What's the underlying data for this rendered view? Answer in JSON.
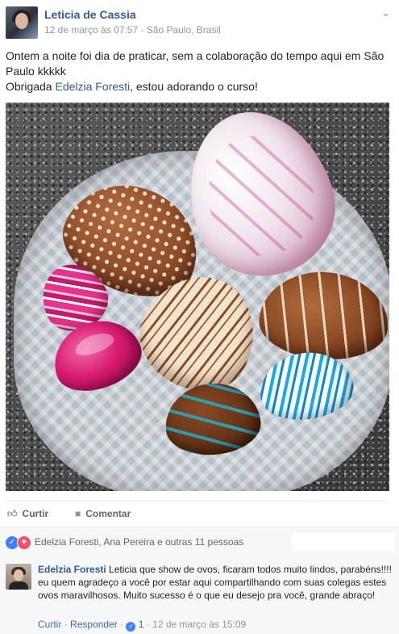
{
  "post": {
    "author": "Leticia de Cassia",
    "date": "12 de março às 07:57",
    "separator": "·",
    "location": "São Paulo, Brasil",
    "menu_icon": "chevron-down-icon",
    "text_line1": "Ontem a noite foi dia de praticar, sem a colaboração do tempo aqui em São Paulo kkkkk",
    "text_prefix": "Obrigada ",
    "text_mention": "Edelzia Foresti",
    "text_suffix": ", estou adorando o curso!"
  },
  "actions": {
    "like_label": "Curtir",
    "comment_label": "Comentar"
  },
  "reactions": {
    "summary": "Edelzia Foresti, Ana Pereira e outras 11 pessoas",
    "colors": {
      "like": "#4080ff",
      "love": "#f25268"
    }
  },
  "comment": {
    "author": "Edelzia Foresti",
    "text": "Leticia que show de ovos, ficaram todos muito lindos, parabéns!!!! eu quem agradeço a você por estar aqui compartilhando com suas colegas estes ovos maravilhosos. Muito sucesso é o que eu desejo pra você, grande abraço!",
    "like_link": "Curtir",
    "dot": "·",
    "reply_link": "Responder",
    "like_count": "1",
    "timestamp": "12 de março às 15:09"
  },
  "theme": {
    "link_color": "#365899",
    "meta_color": "#90949c"
  }
}
